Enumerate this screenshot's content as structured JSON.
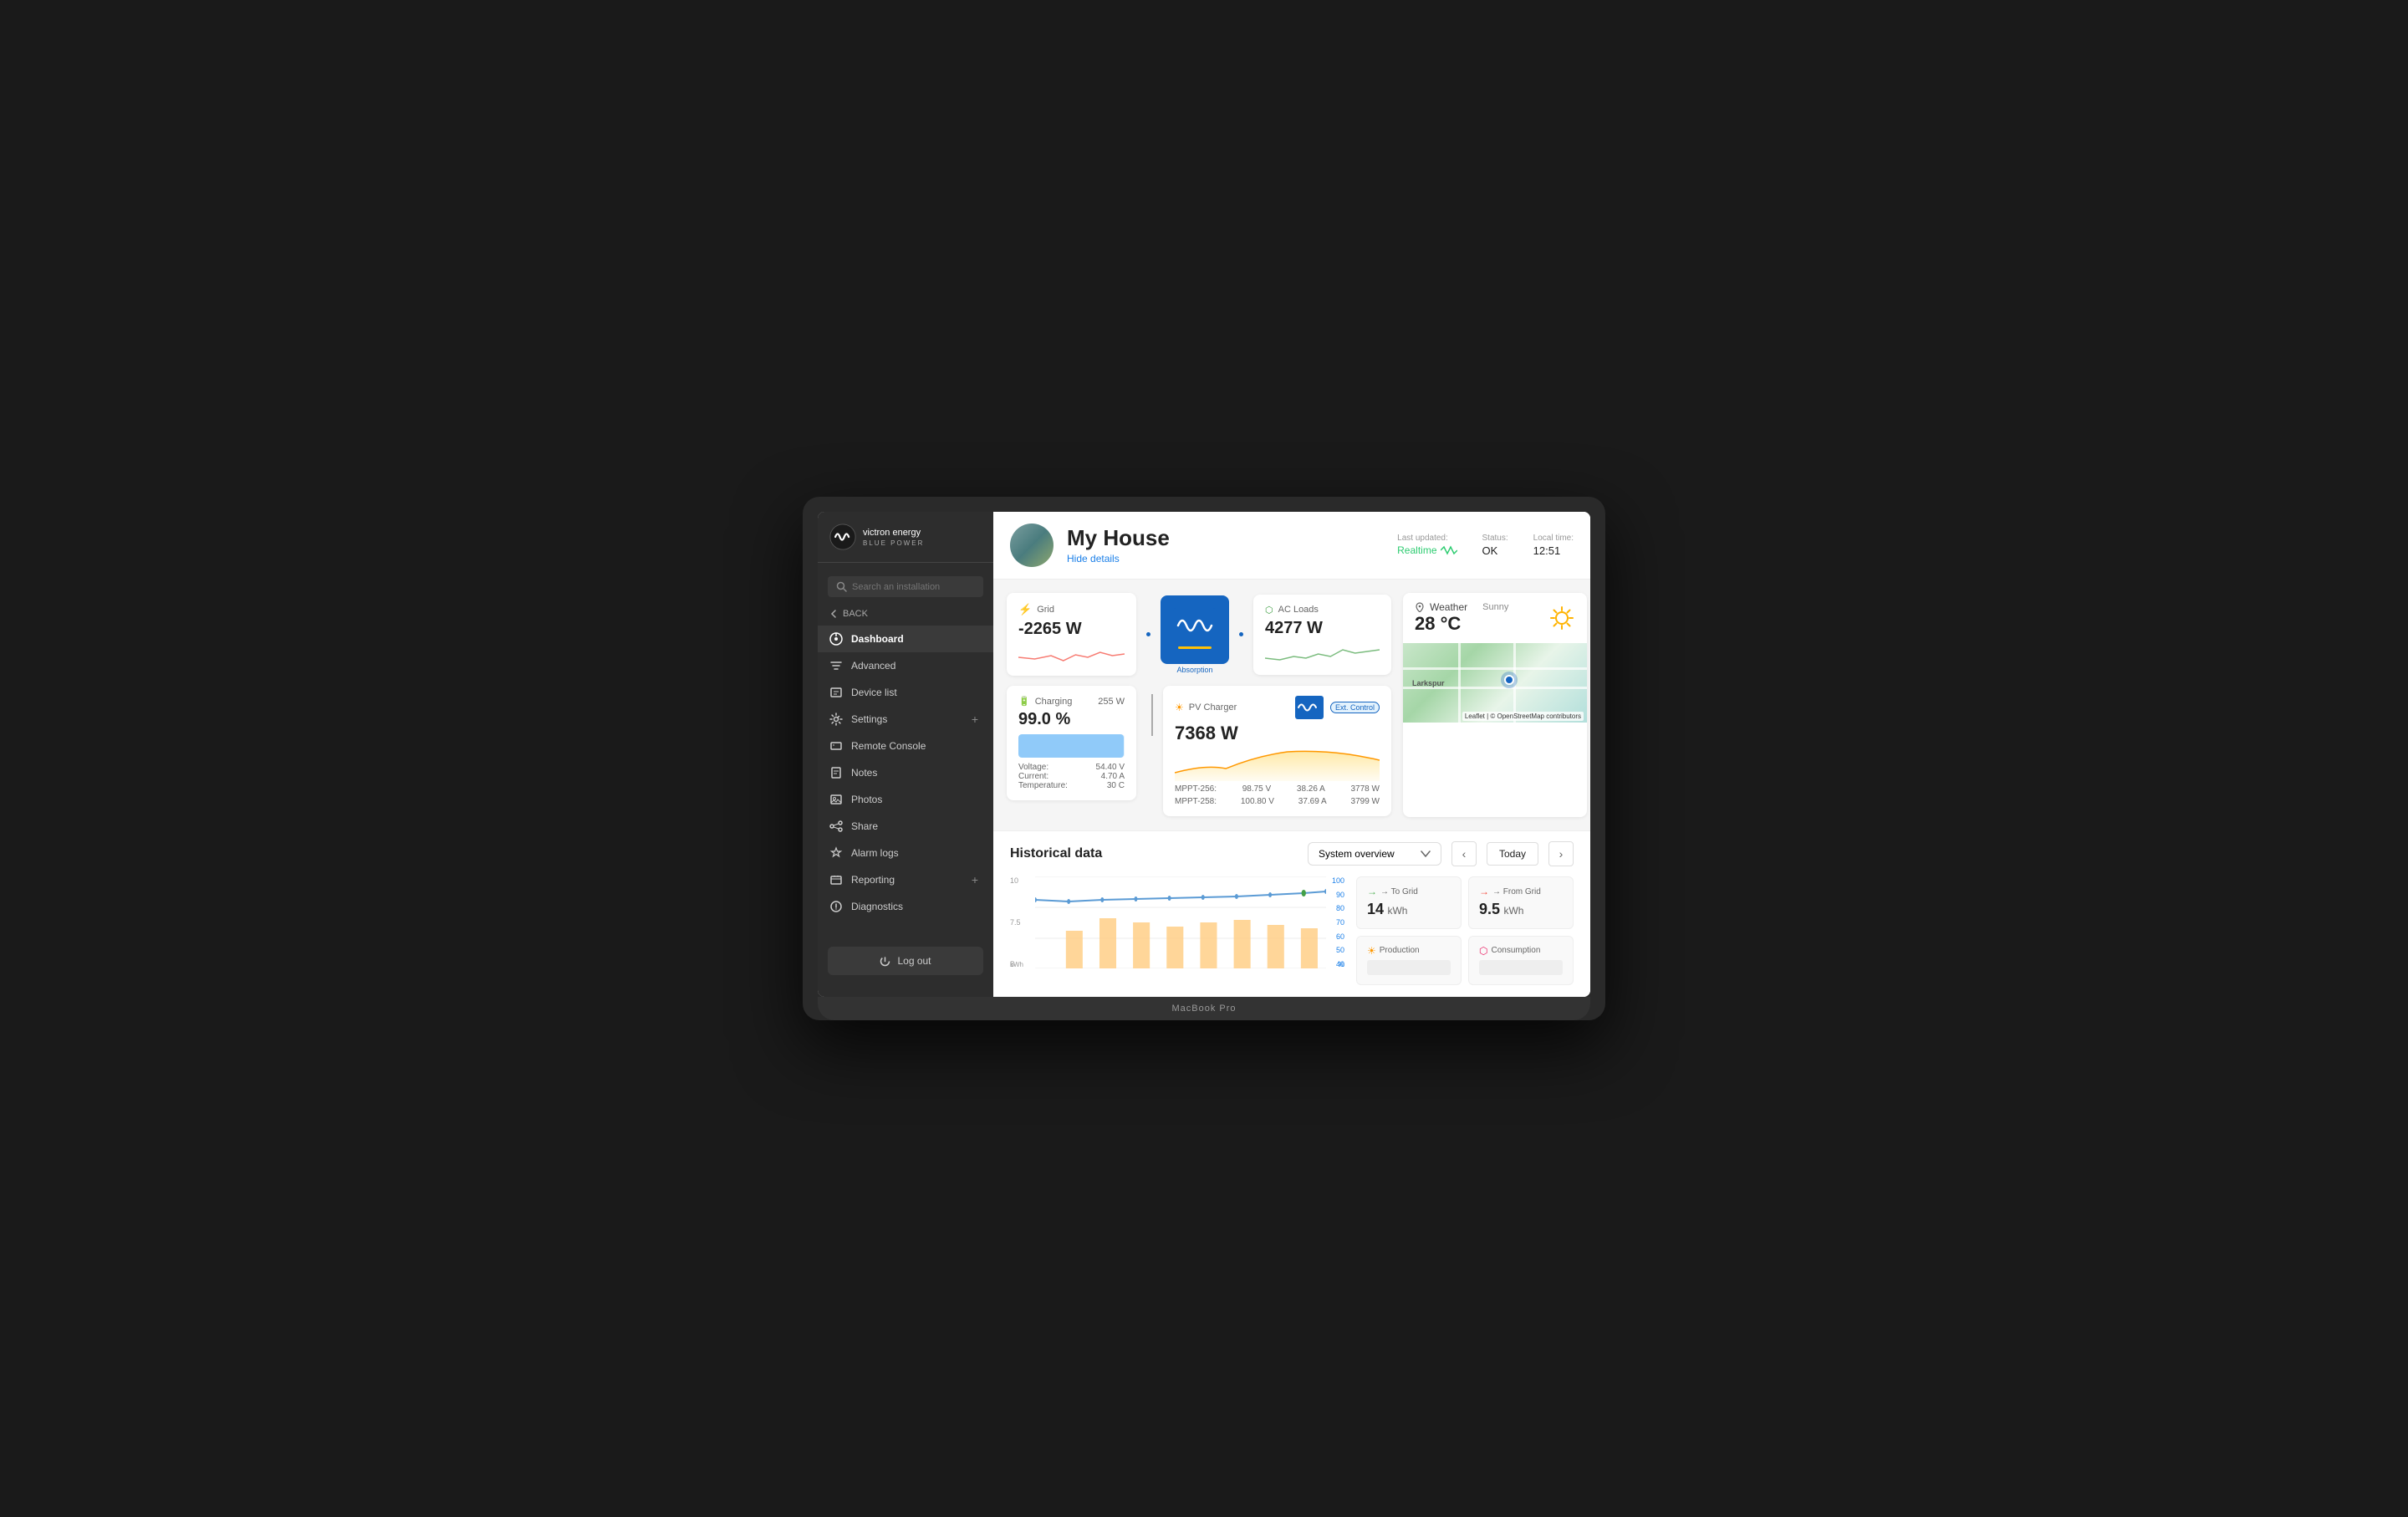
{
  "laptop": {
    "model_label": "MacBook Pro"
  },
  "sidebar": {
    "logo_text": "victron energy",
    "logo_sub": "BLUE POWER",
    "search_placeholder": "Search an installation",
    "back_label": "BACK",
    "nav_items": [
      {
        "id": "dashboard",
        "label": "Dashboard",
        "active": true
      },
      {
        "id": "advanced",
        "label": "Advanced"
      },
      {
        "id": "device-list",
        "label": "Device list"
      },
      {
        "id": "settings",
        "label": "Settings",
        "has_plus": true
      },
      {
        "id": "remote-console",
        "label": "Remote Console"
      },
      {
        "id": "notes",
        "label": "Notes"
      },
      {
        "id": "photos",
        "label": "Photos"
      },
      {
        "id": "share",
        "label": "Share"
      },
      {
        "id": "alarm-logs",
        "label": "Alarm logs"
      },
      {
        "id": "reporting",
        "label": "Reporting",
        "has_plus": true
      },
      {
        "id": "diagnostics",
        "label": "Diagnostics"
      }
    ],
    "logout_label": "Log out"
  },
  "header": {
    "title": "My House",
    "hide_details_label": "Hide details",
    "last_updated_label": "Last updated:",
    "realtime_label": "Realtime",
    "status_label": "Status:",
    "status_value": "OK",
    "local_time_label": "Local time:",
    "local_time_value": "12:51"
  },
  "grid_card": {
    "label": "Grid",
    "value": "-2265 W"
  },
  "inverter": {
    "badge": "Absorption"
  },
  "ac_loads_card": {
    "label": "AC Loads",
    "value": "4277 W"
  },
  "charging_card": {
    "label": "Charging",
    "watts": "255 W",
    "percent": "99.0 %",
    "voltage_label": "Voltage:",
    "voltage_value": "54.40 V",
    "current_label": "Current:",
    "current_value": "4.70 A",
    "temperature_label": "Temperature:",
    "temperature_value": "30 C"
  },
  "pv_charger": {
    "label": "PV Charger",
    "ext_control": "Ext. Control",
    "value": "7368 W",
    "mppt1_label": "MPPT-256:",
    "mppt1_v": "98.75 V",
    "mppt1_a": "38.26 A",
    "mppt1_w": "3778 W",
    "mppt2_label": "MPPT-258:",
    "mppt2_v": "100.80 V",
    "mppt2_a": "37.69 A",
    "mppt2_w": "3799 W"
  },
  "weather": {
    "label": "Weather",
    "condition": "Sunny",
    "temperature": "28 °C",
    "map_credit": "Leaflet | © OpenStreetMap contributors"
  },
  "historical": {
    "title": "Historical data",
    "select_label": "System overview",
    "today_label": "Today",
    "y_axis": [
      "10",
      "7.5",
      "5"
    ],
    "y_axis_right": [
      "100",
      "90",
      "80",
      "70",
      "60",
      "50",
      "40"
    ],
    "y_label": "kWh",
    "y_label_right": "%"
  },
  "stats": {
    "to_grid_label": "→ To Grid",
    "to_grid_value": "14",
    "to_grid_unit": "kWh",
    "from_grid_label": "→ From Grid",
    "from_grid_value": "9.5",
    "from_grid_unit": "kWh",
    "production_label": "Production",
    "consumption_label": "Consumption"
  }
}
